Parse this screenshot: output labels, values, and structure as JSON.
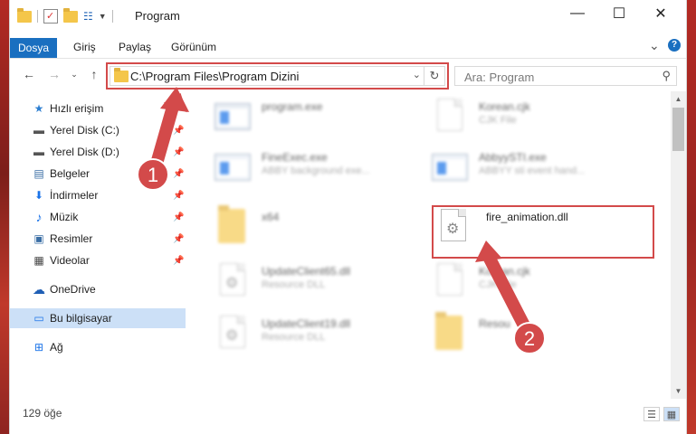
{
  "window": {
    "title": "Program",
    "minimize_glyph": "—",
    "maximize_glyph": "☐",
    "close_glyph": "✕"
  },
  "ribbon": {
    "tabs": [
      "Dosya",
      "Giriş",
      "Paylaş",
      "Görünüm"
    ],
    "collapse_glyph": "⌄",
    "help_glyph": "?"
  },
  "nav": {
    "back_glyph": "←",
    "forward_glyph": "→",
    "recent_glyph": "⌄",
    "up_glyph": "↑"
  },
  "address": {
    "path": "C:\\Program Files\\Program Dizini",
    "dropdown_glyph": "⌄",
    "refresh_glyph": "↻"
  },
  "search": {
    "placeholder": "Ara: Program",
    "icon": "search-icon",
    "glyph": "⚲"
  },
  "sidebar": {
    "items": [
      {
        "label": "Hızlı erişim",
        "icon": "star-icon",
        "glyph": "★",
        "color": "#2d7fd1",
        "pinned": false
      },
      {
        "label": "Yerel Disk (C:)",
        "icon": "drive-icon",
        "glyph": "▬",
        "color": "#555555",
        "pinned": true
      },
      {
        "label": "Yerel Disk (D:)",
        "icon": "drive-icon",
        "glyph": "▬",
        "color": "#555555",
        "pinned": true
      },
      {
        "label": "Belgeler",
        "icon": "documents-icon",
        "glyph": "▤",
        "color": "#3a6ea5",
        "pinned": true
      },
      {
        "label": "İndirmeler",
        "icon": "download-icon",
        "glyph": "⬇",
        "color": "#1a73e8",
        "pinned": true
      },
      {
        "label": "Müzik",
        "icon": "music-icon",
        "glyph": "♪",
        "color": "#1a73e8",
        "pinned": true
      },
      {
        "label": "Resimler",
        "icon": "pictures-icon",
        "glyph": "▣",
        "color": "#3a6ea5",
        "pinned": true
      },
      {
        "label": "Videolar",
        "icon": "video-icon",
        "glyph": "▦",
        "color": "#444444",
        "pinned": true
      },
      {
        "label": "OneDrive",
        "icon": "cloud-icon",
        "glyph": "☁",
        "color": "#1f5fb5",
        "pinned": false
      },
      {
        "label": "Bu bilgisayar",
        "icon": "computer-icon",
        "glyph": "▭",
        "color": "#1a73e8",
        "pinned": false
      },
      {
        "label": "Ağ",
        "icon": "network-icon",
        "glyph": "⊞",
        "color": "#1a73e8",
        "pinned": false
      }
    ],
    "pin_glyph": "📌"
  },
  "files": [
    {
      "name": "program.exe",
      "desc": "",
      "type": "exe",
      "blurred": true
    },
    {
      "name": "Korean.cjk",
      "desc": "CJK File",
      "type": "doc",
      "blurred": true
    },
    {
      "name": "FineExec.exe",
      "desc": "ABBY background exe...",
      "type": "exe",
      "blurred": true
    },
    {
      "name": "AbbyySTI.exe",
      "desc": "ABBYY sti event hand...",
      "type": "exe",
      "blurred": true
    },
    {
      "name": "x64",
      "desc": "",
      "type": "folder",
      "blurred": true
    },
    {
      "name": "fire_animation.dll",
      "desc": "",
      "type": "dll",
      "blurred": false
    },
    {
      "name": "UpdateClient65.dll",
      "desc": "Resource DLL",
      "type": "dll",
      "blurred": true
    },
    {
      "name": "Korean.cjk",
      "desc": "CJK File",
      "type": "doc",
      "blurred": true
    },
    {
      "name": "UpdateClient19.dll",
      "desc": "Resource DLL",
      "type": "dll",
      "blurred": true
    },
    {
      "name": "Resou",
      "desc": "",
      "type": "folder",
      "blurred": true
    }
  ],
  "annotations": {
    "step1": "1",
    "step2": "2",
    "color": "#d34a4a"
  },
  "status": {
    "count": "129 öğe"
  },
  "scrollbar": {
    "up_glyph": "▲",
    "down_glyph": "▼"
  }
}
